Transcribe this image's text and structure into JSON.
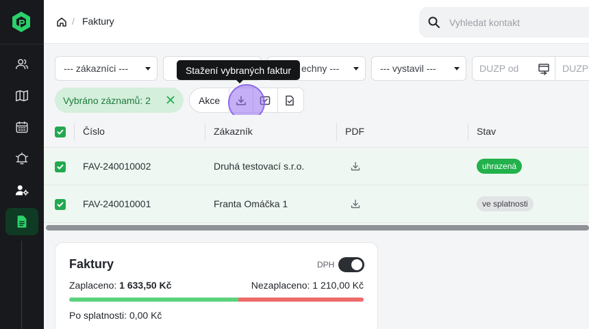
{
  "header": {
    "breadcrumb_separator": "/",
    "title": "Faktury",
    "search_placeholder": "Vyhledat kontakt"
  },
  "sidebar": {
    "items": [
      {
        "icon": "contacts-icon"
      },
      {
        "icon": "map-icon"
      },
      {
        "icon": "calendar-icon"
      },
      {
        "icon": "bell-icon"
      },
      {
        "icon": "user-settings-icon"
      },
      {
        "icon": "document-icon",
        "active": true
      }
    ]
  },
  "filters": {
    "customers": "--- zákazníci ---",
    "second": "",
    "status_partial": "echny ---",
    "issued_by": "--- vystavil ---",
    "duzp_from": "DUZP od",
    "duzp_to": "DUZP"
  },
  "tooltip": "Stažení vybraných faktur",
  "selection": {
    "label": "Vybráno záznamů: 2",
    "actions_label": "Akce"
  },
  "table": {
    "columns": [
      "Číslo",
      "Zákazník",
      "PDF",
      "Stav"
    ],
    "rows": [
      {
        "number": "FAV-240010002",
        "customer": "Druhá testovací s.r.o.",
        "status": "uhrazená"
      },
      {
        "number": "FAV-240010001",
        "customer": "Franta Omáčka 1",
        "status": "ve splatnosti"
      }
    ]
  },
  "summary": {
    "title": "Faktury",
    "dph_label": "DPH",
    "paid_label": "Zaplaceno:",
    "paid_value": "1 633,50 Kč",
    "unpaid_text": "Nezaplaceno: 1 210,00 Kč",
    "overdue_text": "Po splatnosti: 0,00 Kč",
    "paid_fraction": 0.574
  },
  "colors": {
    "accent": "#22a94f",
    "paid_bar": "#5bd27c",
    "unpaid_bar": "#ee6b6b"
  }
}
